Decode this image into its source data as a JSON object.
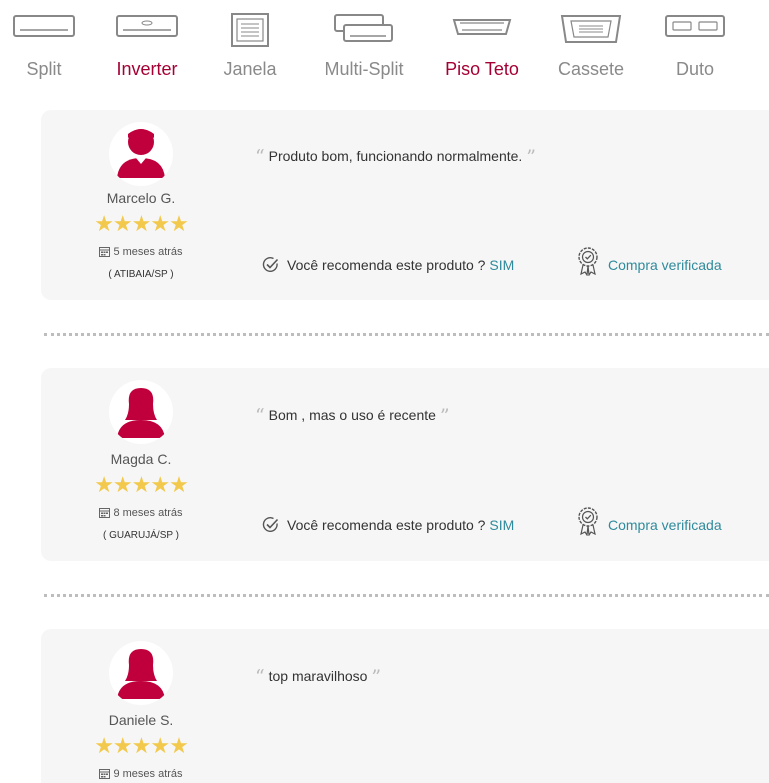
{
  "categories": [
    {
      "label": "Split",
      "icon": "split-ac-icon",
      "active": false
    },
    {
      "label": "Inverter",
      "icon": "inverter-ac-icon",
      "active": true
    },
    {
      "label": "Janela",
      "icon": "window-ac-icon",
      "active": false
    },
    {
      "label": "Multi-Split",
      "icon": "multi-split-ac-icon",
      "active": false
    },
    {
      "label": "Piso Teto",
      "icon": "floor-ceiling-ac-icon",
      "active": true
    },
    {
      "label": "Cassete",
      "icon": "cassette-ac-icon",
      "active": false
    },
    {
      "label": "Duto",
      "icon": "duct-ac-icon",
      "active": false
    }
  ],
  "reviews": [
    {
      "name": "Marcelo G.",
      "avatar": "male-avatar-icon",
      "rating": 5,
      "stars": "★★★★★",
      "date": "5 meses atrás",
      "location": "( ATIBAIA/SP )",
      "text": "Produto bom, funcionando normalmente.",
      "recommend_label": "Você recomenda este produto ?",
      "recommend_value": "SIM",
      "verified_label": "Compra verificada"
    },
    {
      "name": "Magda C.",
      "avatar": "female-avatar-icon",
      "rating": 5,
      "stars": "★★★★★",
      "date": "8 meses atrás",
      "location": "( GUARUJÁ/SP )",
      "text": "Bom , mas o uso é recente",
      "recommend_label": "Você recomenda este produto ?",
      "recommend_value": "SIM",
      "verified_label": "Compra verificada"
    },
    {
      "name": "Daniele S.",
      "avatar": "female-avatar-icon",
      "rating": 5,
      "stars": "★★★★★",
      "date": "9 meses atrás",
      "text": "top maravilhoso"
    }
  ],
  "colors": {
    "brand": "#a50034",
    "muted_label": "#8a8a8a",
    "star": "#f2c94c",
    "link": "#2f8a9c",
    "card_bg": "#f6f6f6"
  }
}
